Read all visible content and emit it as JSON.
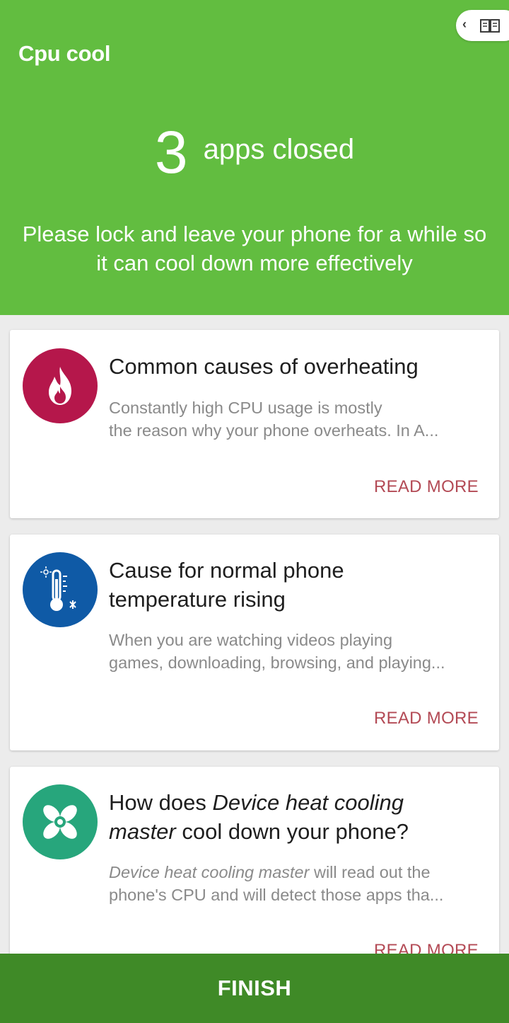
{
  "header": {
    "app_title": "Cpu cool",
    "apps_closed_count": "3",
    "apps_closed_label": "apps closed",
    "tip": "Please lock and leave your phone for a while so it can cool down more effectively"
  },
  "reader_button": {
    "chevron": "‹",
    "icon": "book-icon"
  },
  "colors": {
    "header_bg": "#62bd40",
    "finish_bg": "#3f8a27",
    "read_more": "#b34a55",
    "icon_fire_bg": "#b5174b",
    "icon_thermo_bg": "#0f5aa6",
    "icon_fan_bg": "#27a67c"
  },
  "cards": [
    {
      "icon": "fire-icon",
      "title": "Common causes of overheating",
      "desc_line1": "Constantly high CPU usage is mostly",
      "desc_line2": "the reason why your phone overheats. In A...",
      "action": "READ MORE"
    },
    {
      "icon": "thermometer-icon",
      "title_line1": "Cause for normal phone",
      "title_line2": "temperature rising",
      "desc_line1": "When you are watching videos playing",
      "desc_line2": "games, downloading, browsing, and playing...",
      "action": "READ MORE"
    },
    {
      "icon": "fan-icon",
      "title_pre": "How does ",
      "title_italic": "Device heat cooling",
      "title_italic2": "master",
      "title_post": " cool down your phone?",
      "desc_italic": "Device heat cooling master",
      "desc_rest1": " will read out the",
      "desc_line2": "phone's CPU and will detect those apps tha...",
      "action": "READ MORE"
    }
  ],
  "finish_label": "FINISH"
}
